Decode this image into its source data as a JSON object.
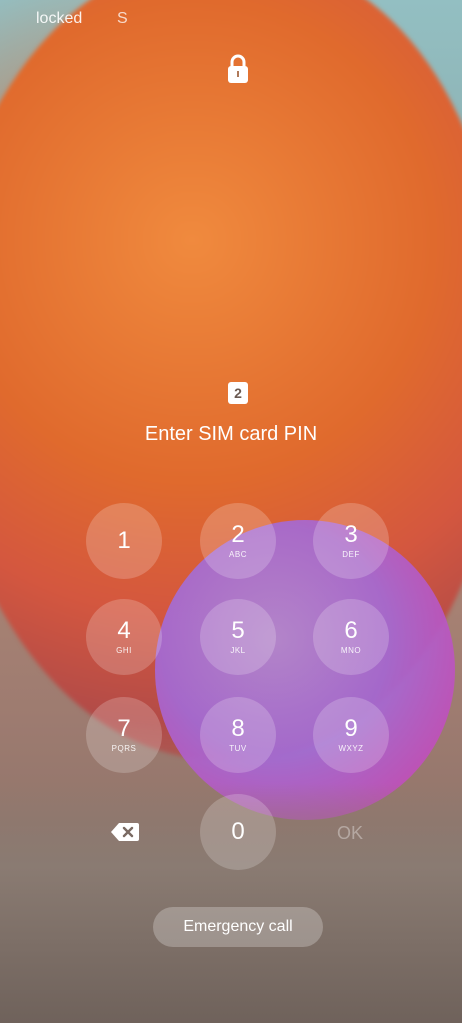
{
  "status_bar": {
    "left_text": "locked",
    "extra_text": "S"
  },
  "lock": {
    "icon": "lock-icon"
  },
  "sim": {
    "slot_label": "2",
    "title": "Enter SIM card PIN"
  },
  "keypad": {
    "keys": [
      {
        "digit": "1",
        "letters": ""
      },
      {
        "digit": "2",
        "letters": "ABC"
      },
      {
        "digit": "3",
        "letters": "DEF"
      },
      {
        "digit": "4",
        "letters": "GHI"
      },
      {
        "digit": "5",
        "letters": "JKL"
      },
      {
        "digit": "6",
        "letters": "MNO"
      },
      {
        "digit": "7",
        "letters": "PQRS"
      },
      {
        "digit": "8",
        "letters": "TUV"
      },
      {
        "digit": "9",
        "letters": "WXYZ"
      },
      {
        "digit": "0",
        "letters": ""
      }
    ],
    "ok_label": "OK",
    "backspace_icon": "backspace-icon"
  },
  "emergency": {
    "label": "Emergency call"
  }
}
